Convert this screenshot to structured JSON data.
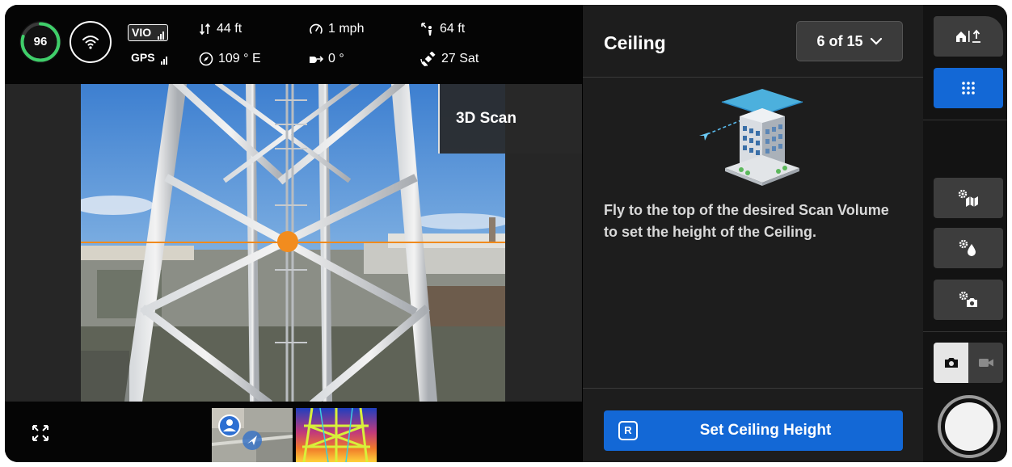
{
  "telemetry": {
    "battery": "96",
    "vio_label": "VIO",
    "gps_label": "GPS",
    "vertical_distance": "44 ft",
    "heading": "109 ° E",
    "speed": "1 mph",
    "gimbal_angle": "0 °",
    "distance_from_home": "64 ft",
    "satellites": "27 Sat"
  },
  "camera": {
    "mode_tag": "3D Scan"
  },
  "panel": {
    "title": "Ceiling",
    "step_indicator": "6 of 15",
    "instruction": "Fly to the top of the desired Scan Volume to set the height of the Ceiling.",
    "action_key": "R",
    "action_label": "Set Ceiling Height"
  },
  "colors": {
    "accent_blue": "#1368d6",
    "horizon_orange": "#f08a1c",
    "battery_green": "#3fcf6a",
    "panel_bg": "#1d1d1d"
  },
  "icons": {
    "rail": [
      "home-altitude-icon",
      "grid-dots-icon",
      "gear-map-icon",
      "gear-drop-icon",
      "gear-camera-icon",
      "photo-camera-icon",
      "video-camera-icon"
    ],
    "telemetry": [
      "vertical-arrows-icon",
      "compass-icon",
      "speedometer-icon",
      "gimbal-icon",
      "home-distance-icon",
      "satellite-icon",
      "wifi-icon"
    ]
  }
}
